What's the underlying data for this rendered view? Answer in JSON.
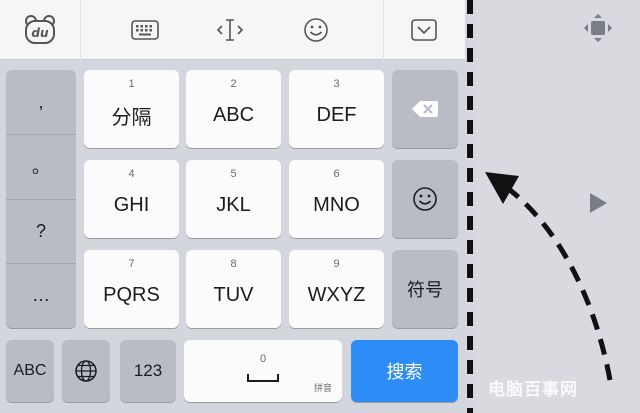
{
  "toolbar": {
    "logo_text": "du",
    "icons": [
      "keyboard-icon",
      "cursor-move-icon",
      "emoji-icon",
      "collapse-keyboard-icon"
    ]
  },
  "punctuation": [
    ",",
    "。",
    "?",
    "…"
  ],
  "keys": [
    {
      "num": "1",
      "label": "分隔"
    },
    {
      "num": "2",
      "label": "ABC"
    },
    {
      "num": "3",
      "label": "DEF"
    },
    {
      "num": "4",
      "label": "GHI"
    },
    {
      "num": "5",
      "label": "JKL"
    },
    {
      "num": "6",
      "label": "MNO"
    },
    {
      "num": "7",
      "label": "PQRS"
    },
    {
      "num": "8",
      "label": "TUV"
    },
    {
      "num": "9",
      "label": "WXYZ"
    }
  ],
  "right_keys": {
    "symbols": "符号"
  },
  "bottom": {
    "abc": "ABC",
    "num": "123",
    "space_num": "0",
    "space_hint": "拼音",
    "search": "搜索"
  },
  "colors": {
    "accent": "#2d8cf5",
    "key_bg": "#fbfbfc",
    "key_gray": "#b9bcc4",
    "dash": "#111111"
  },
  "watermark": "电脑百事网"
}
